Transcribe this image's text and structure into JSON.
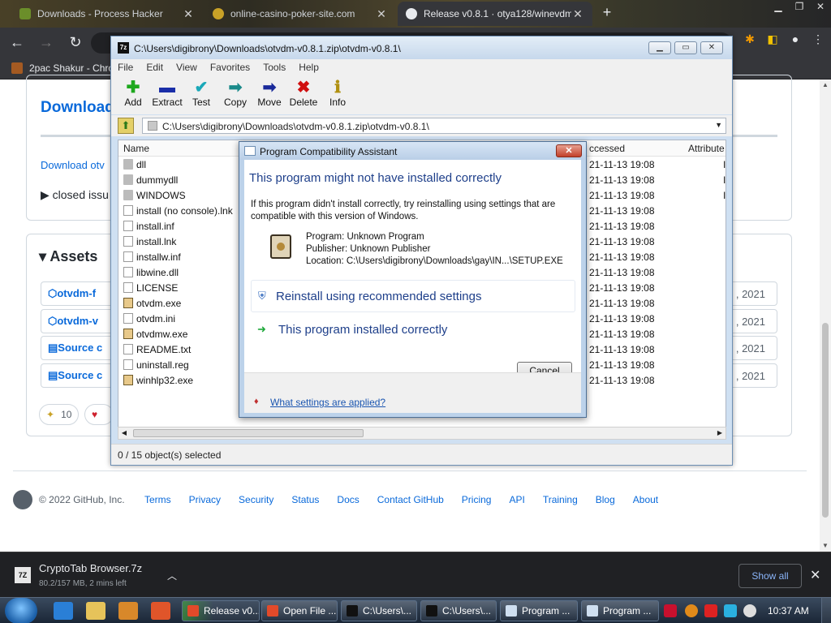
{
  "browser": {
    "tabs": [
      {
        "label": "Downloads - Process Hacker",
        "active": false
      },
      {
        "label": "online-casino-poker-site.com",
        "active": false
      },
      {
        "label": "Release v0.8.1 · otya128/winevdm",
        "active": true
      }
    ],
    "new_tab": "+",
    "bookmark": "2pac Shakur - Chro"
  },
  "github": {
    "downloads_heading": "Download",
    "download_link": "Download otv",
    "closed_issues": "closed issu",
    "assets_heading": "Assets",
    "assets": [
      {
        "name": "otvdm-f",
        "date": ", 2021"
      },
      {
        "name": "otvdm-v",
        "date": ", 2021"
      },
      {
        "name": "Source c",
        "date": ", 2021"
      },
      {
        "name": "Source c",
        "date": ", 2021"
      }
    ],
    "reaction_count": "10",
    "footer": {
      "copyright": "© 2022 GitHub, Inc.",
      "links": [
        "Terms",
        "Privacy",
        "Security",
        "Status",
        "Docs",
        "Contact GitHub",
        "Pricing",
        "API",
        "Training",
        "Blog",
        "About"
      ]
    }
  },
  "zip": {
    "title": "C:\\Users\\digibrony\\Downloads\\otvdm-v0.8.1.zip\\otvdm-v0.8.1\\",
    "menu": [
      "File",
      "Edit",
      "View",
      "Favorites",
      "Tools",
      "Help"
    ],
    "tools": [
      {
        "label": "Add",
        "glyph": "✚",
        "color": "#1ea81e"
      },
      {
        "label": "Extract",
        "glyph": "▬",
        "color": "#1a2ea8"
      },
      {
        "label": "Test",
        "glyph": "✔",
        "color": "#1aa8b8"
      },
      {
        "label": "Copy",
        "glyph": "➡",
        "color": "#1a8a8a"
      },
      {
        "label": "Move",
        "glyph": "➡",
        "color": "#1a2a9a"
      },
      {
        "label": "Delete",
        "glyph": "✖",
        "color": "#d01010"
      },
      {
        "label": "Info",
        "glyph": "ℹ",
        "color": "#b09010"
      }
    ],
    "path": "C:\\Users\\digibrony\\Downloads\\otvdm-v0.8.1.zip\\otvdm-v0.8.1\\",
    "columns": {
      "name": "Name",
      "accessed": "ccessed",
      "attributes": "Attribute"
    },
    "files": [
      {
        "name": "dll",
        "type": "folder",
        "date": "21-11-13 19:08",
        "attr": "I"
      },
      {
        "name": "dummydll",
        "type": "folder",
        "date": "21-11-13 19:08",
        "attr": "I"
      },
      {
        "name": "WINDOWS",
        "type": "folder",
        "date": "21-11-13 19:08",
        "attr": "I"
      },
      {
        "name": "install (no console).lnk",
        "type": "file",
        "date": "21-11-13 19:08",
        "attr": ""
      },
      {
        "name": "install.inf",
        "type": "file",
        "date": "21-11-13 19:08",
        "attr": ""
      },
      {
        "name": "install.lnk",
        "type": "file",
        "date": "21-11-13 19:08",
        "attr": ""
      },
      {
        "name": "installw.inf",
        "type": "file",
        "date": "21-11-13 19:08",
        "attr": ""
      },
      {
        "name": "libwine.dll",
        "type": "file",
        "date": "21-11-13 19:08",
        "attr": ""
      },
      {
        "name": "LICENSE",
        "type": "file",
        "date": "21-11-13 19:08",
        "attr": ""
      },
      {
        "name": "otvdm.exe",
        "type": "exe",
        "date": "21-11-13 19:08",
        "attr": ""
      },
      {
        "name": "otvdm.ini",
        "type": "file",
        "date": "21-11-13 19:08",
        "attr": ""
      },
      {
        "name": "otvdmw.exe",
        "type": "exe",
        "date": "21-11-13 19:08",
        "attr": ""
      },
      {
        "name": "README.txt",
        "type": "file",
        "date": "21-11-13 19:08",
        "attr": ""
      },
      {
        "name": "uninstall.reg",
        "type": "file",
        "date": "21-11-13 19:08",
        "attr": ""
      },
      {
        "name": "winhlp32.exe",
        "type": "exe",
        "date": "21-11-13 19:08",
        "attr": ""
      }
    ],
    "status": "0 / 15 object(s) selected"
  },
  "pca": {
    "title": "Program Compatibility Assistant",
    "heading": "This program might not have installed correctly",
    "description": "If this program didn't install correctly, try reinstalling using settings that are compatible with this version of Windows.",
    "program": "Program: Unknown Program",
    "publisher": "Publisher: Unknown Publisher",
    "location": "Location: C:\\Users\\digibrony\\Downloads\\gay\\IN...\\SETUP.EXE",
    "option_reinstall": "Reinstall using recommended settings",
    "option_correct": "This program installed correctly",
    "cancel": "Cancel",
    "help_link": "What settings are applied?"
  },
  "downloads_bar": {
    "file": "CryptoTab Browser.7z",
    "status": "80.2/157 MB, 2 mins left",
    "show_all": "Show all"
  },
  "taskbar": {
    "buttons": [
      "Release v0...",
      "Open File ...",
      "C:\\Users\\...",
      "C:\\Users\\...",
      "Program ...",
      "Program ..."
    ],
    "clock": "10:37 AM"
  }
}
